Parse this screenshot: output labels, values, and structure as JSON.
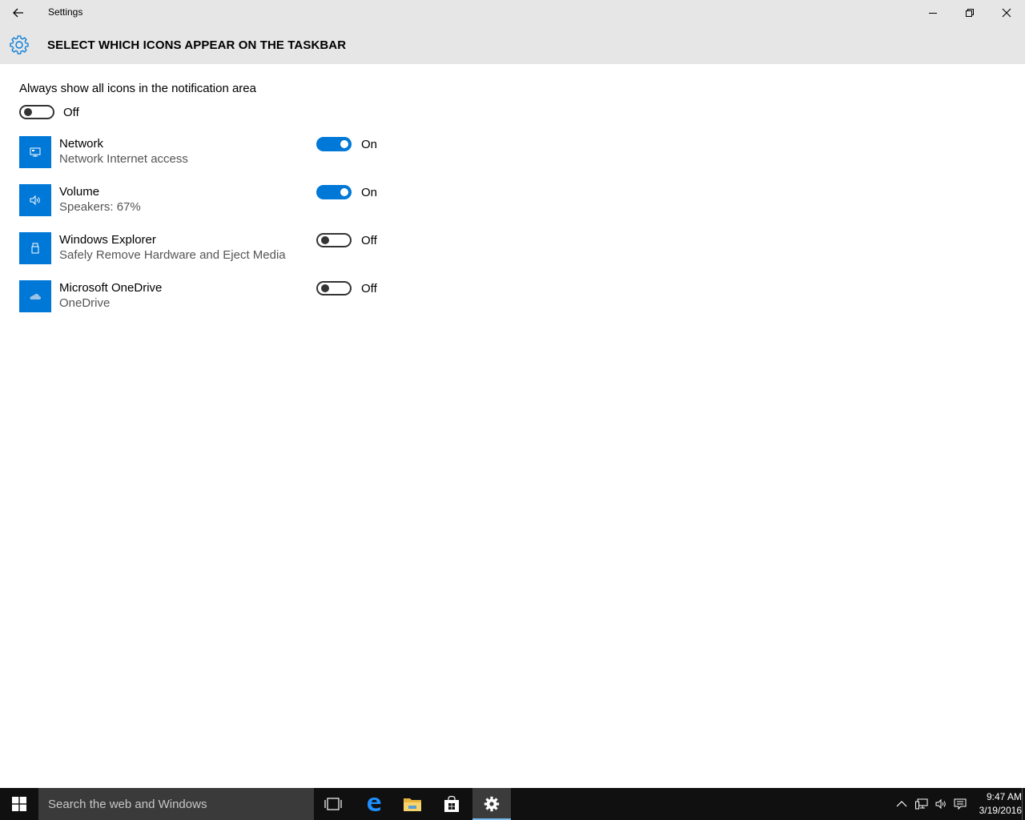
{
  "window": {
    "title": "Settings"
  },
  "header": {
    "title": "SELECT WHICH ICONS APPEAR ON THE TASKBAR",
    "icon": "gear-icon"
  },
  "always_show": {
    "label": "Always show all icons in the notification area",
    "state": "Off",
    "on": false
  },
  "items": [
    {
      "name": "Network",
      "description": "Network Internet access",
      "state": "On",
      "on": true,
      "icon": "network-icon"
    },
    {
      "name": "Volume",
      "description": "Speakers: 67%",
      "state": "On",
      "on": true,
      "icon": "speaker-icon"
    },
    {
      "name": "Windows Explorer",
      "description": "Safely Remove Hardware and Eject Media",
      "state": "Off",
      "on": false,
      "icon": "usb-drive-icon"
    },
    {
      "name": "Microsoft OneDrive",
      "description": "OneDrive",
      "state": "Off",
      "on": false,
      "icon": "cloud-icon"
    }
  ],
  "taskbar": {
    "search_placeholder": "Search the web and Windows",
    "time": "9:47 AM",
    "date": "3/19/2016"
  },
  "colors": {
    "accent": "#0078d7",
    "titlebar": "#e6e6e6",
    "taskbar": "#101010"
  }
}
